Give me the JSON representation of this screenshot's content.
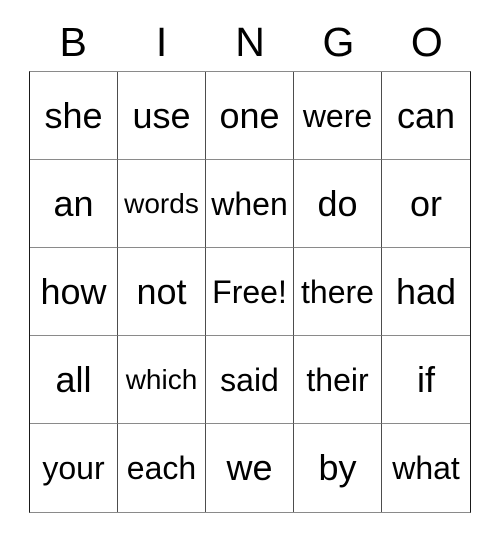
{
  "card": {
    "title": "BINGO",
    "headers": [
      "B",
      "I",
      "N",
      "G",
      "O"
    ],
    "free_space_label": "Free!",
    "free_space_position": {
      "row": 2,
      "col": 2
    },
    "rows": [
      {
        "cells": [
          {
            "text": "she",
            "size": "lg",
            "free": false
          },
          {
            "text": "use",
            "size": "lg",
            "free": false
          },
          {
            "text": "one",
            "size": "lg",
            "free": false
          },
          {
            "text": "were",
            "size": "md",
            "free": false
          },
          {
            "text": "can",
            "size": "lg",
            "free": false
          }
        ]
      },
      {
        "cells": [
          {
            "text": "an",
            "size": "lg",
            "free": false
          },
          {
            "text": "words",
            "size": "sm",
            "free": false
          },
          {
            "text": "when",
            "size": "md",
            "free": false
          },
          {
            "text": "do",
            "size": "lg",
            "free": false
          },
          {
            "text": "or",
            "size": "lg",
            "free": false
          }
        ]
      },
      {
        "cells": [
          {
            "text": "how",
            "size": "lg",
            "free": false
          },
          {
            "text": "not",
            "size": "lg",
            "free": false
          },
          {
            "text": "Free!",
            "size": "md",
            "free": true
          },
          {
            "text": "there",
            "size": "md",
            "free": false
          },
          {
            "text": "had",
            "size": "lg",
            "free": false
          }
        ]
      },
      {
        "cells": [
          {
            "text": "all",
            "size": "lg",
            "free": false
          },
          {
            "text": "which",
            "size": "sm",
            "free": false
          },
          {
            "text": "said",
            "size": "md",
            "free": false
          },
          {
            "text": "their",
            "size": "md",
            "free": false
          },
          {
            "text": "if",
            "size": "lg",
            "free": false
          }
        ]
      },
      {
        "cells": [
          {
            "text": "your",
            "size": "md",
            "free": false
          },
          {
            "text": "each",
            "size": "md",
            "free": false
          },
          {
            "text": "we",
            "size": "lg",
            "free": false
          },
          {
            "text": "by",
            "size": "lg",
            "free": false
          },
          {
            "text": "what",
            "size": "md",
            "free": false
          }
        ]
      }
    ]
  },
  "colors": {
    "background": "#ffffff",
    "text": "#000000",
    "grid_line": "#4d4d4d",
    "grid_line_light": "#8a8a8a"
  }
}
